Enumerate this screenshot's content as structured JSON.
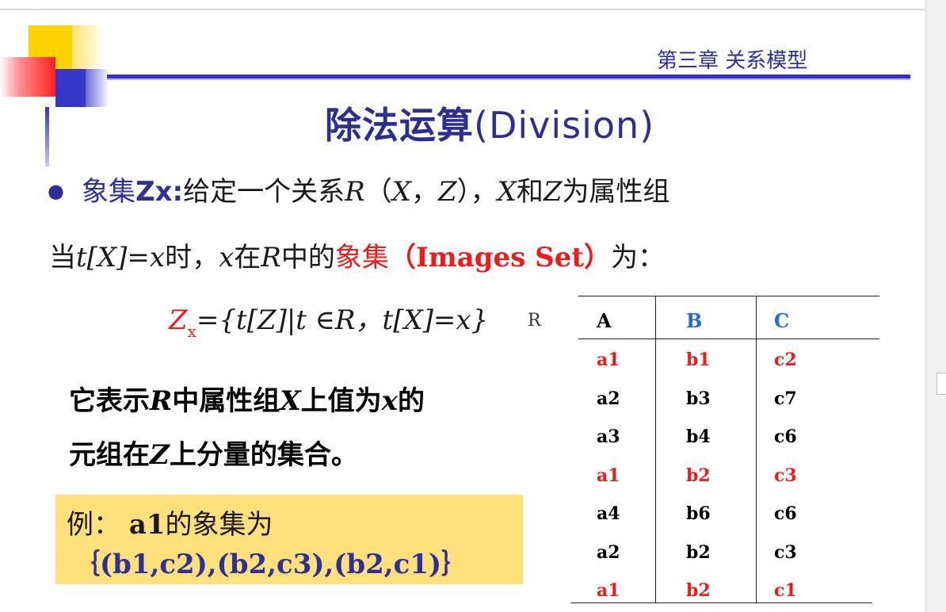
{
  "header": {
    "chapter": "第三章 关系模型",
    "title_cn": "除法运算",
    "title_en": "(Division)"
  },
  "definition": {
    "term": "象集",
    "term_var": "Zx:",
    "text_a": "给定一个关系",
    "R": "R",
    "paren_open": "（",
    "X": "X",
    "comma": "，",
    "Z": "Z",
    "paren_close": "）",
    "comma2": "，",
    "X2": "X",
    "and": "和",
    "Z2": "Z",
    "tail": "为属性组"
  },
  "line2": {
    "when": "当",
    "t": "t",
    "bracketX": "[X]=x",
    "shi": "时，",
    "x": "x",
    "zai": "在",
    "R": "R",
    "zhongde": "中的",
    "images_cn": "象集",
    "images_en": "（Images Set）",
    "wei": "为："
  },
  "formula": {
    "Z": "Z",
    "sub": "x",
    "rest": "={t[Z]|t ∈R，t[X]=x}"
  },
  "relation_label": "R",
  "description": {
    "l1_a": "它表示",
    "l1_R": "R",
    "l1_b": "中属性组",
    "l1_X": "X",
    "l1_c": "上值为",
    "l1_x": "x",
    "l1_d": "的",
    "l2_a": "元组在",
    "l2_Z": "Z",
    "l2_b": "上分量的集合。"
  },
  "example": {
    "label": "例：",
    "subject": "a1",
    "text": "的象集为",
    "result": "｛(b1,c2),(b2,c3),(b2,c1)｝"
  },
  "table": {
    "headers": [
      "A",
      "B",
      "C"
    ],
    "rows": [
      [
        "a1",
        "b1",
        "c2"
      ],
      [
        "a2",
        "b3",
        "c7"
      ],
      [
        "a3",
        "b4",
        "c6"
      ],
      [
        "a1",
        "b2",
        "c3"
      ],
      [
        "a4",
        "b6",
        "c6"
      ],
      [
        "a2",
        "b2",
        "c3"
      ],
      [
        "a1",
        "b2",
        "c1"
      ]
    ],
    "highlighted_rows": [
      0,
      3,
      6
    ]
  },
  "colors": {
    "navy": "#2f2f9a",
    "red": "#ee1b1b",
    "header_blue": "#1f6fc4",
    "example_bg": "#ffe07a"
  }
}
